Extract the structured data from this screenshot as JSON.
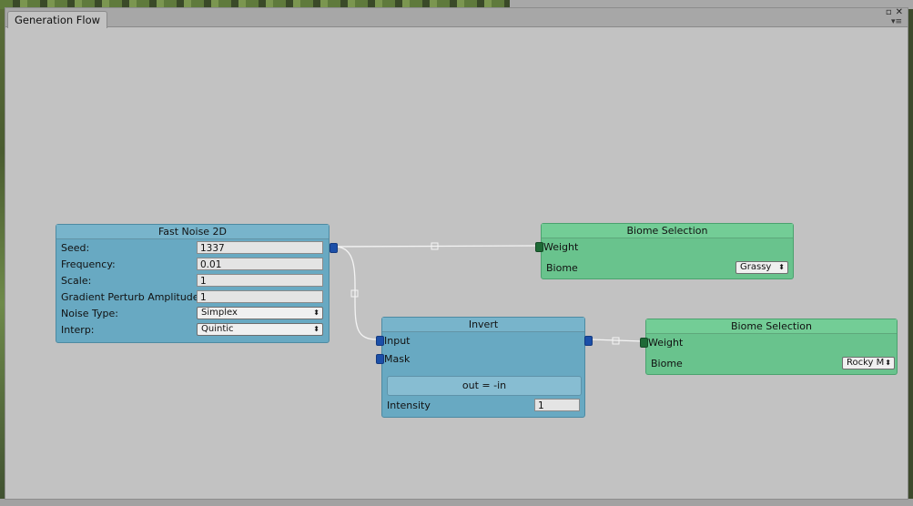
{
  "window": {
    "tab_title": "Generation Flow"
  },
  "nodes": {
    "fast_noise": {
      "title": "Fast Noise 2D",
      "seed_label": "Seed:",
      "seed_value": "1337",
      "frequency_label": "Frequency:",
      "frequency_value": "0.01",
      "scale_label": "Scale:",
      "scale_value": "1",
      "gradient_label": "Gradient Perturb Amplitude:",
      "gradient_value": "1",
      "noise_type_label": "Noise Type:",
      "noise_type_value": "Simplex",
      "interp_label": "Interp:",
      "interp_value": "Quintic"
    },
    "invert": {
      "title": "Invert",
      "input_label": "Input",
      "mask_label": "Mask",
      "expression": "out = -in",
      "intensity_label": "Intensity",
      "intensity_value": "1"
    },
    "biome_1": {
      "title": "Biome Selection",
      "weight_label": "Weight",
      "biome_label": "Biome",
      "biome_value": "Grassy"
    },
    "biome_2": {
      "title": "Biome Selection",
      "weight_label": "Weight",
      "biome_label": "Biome",
      "biome_value": "Rocky M"
    }
  },
  "colors": {
    "canvas": "#c2c2c2",
    "node_blue": "#68a9c2",
    "node_green": "#69c38d",
    "port_blue": "#1c4fa8",
    "port_green": "#1e6a36"
  },
  "icons": {
    "close": "close-icon",
    "maximize": "maximize-icon",
    "menu": "context-menu-icon",
    "dropdown": "dropdown-arrows-icon"
  }
}
